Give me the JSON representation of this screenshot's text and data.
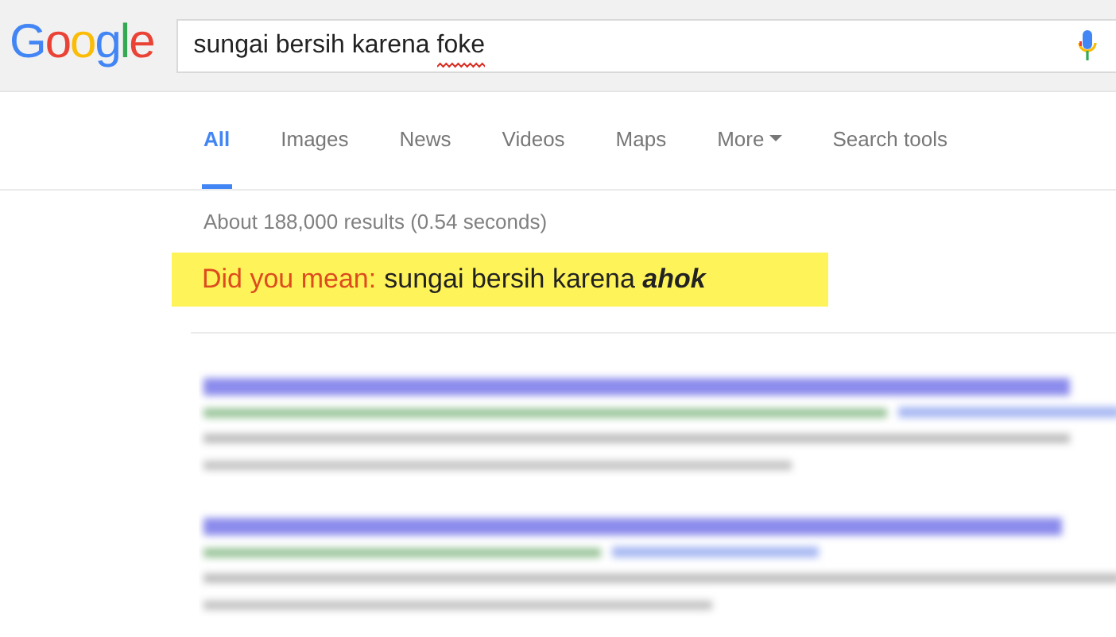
{
  "logo": "Google",
  "query_words": [
    {
      "text": "sungai",
      "misspelled": false
    },
    {
      "text": "bersih",
      "misspelled": false
    },
    {
      "text": "karena",
      "misspelled": false
    },
    {
      "text": "foke",
      "misspelled": true
    }
  ],
  "tabs": [
    {
      "label": "All",
      "selected": true,
      "kind": "tab"
    },
    {
      "label": "Images",
      "selected": false,
      "kind": "tab"
    },
    {
      "label": "News",
      "selected": false,
      "kind": "tab"
    },
    {
      "label": "Videos",
      "selected": false,
      "kind": "tab"
    },
    {
      "label": "Maps",
      "selected": false,
      "kind": "tab"
    },
    {
      "label": "More",
      "selected": false,
      "kind": "menu"
    },
    {
      "label": "Search tools",
      "selected": false,
      "kind": "tab"
    }
  ],
  "result_stats": "About 188,000 results (0.54 seconds)",
  "did_you_mean": {
    "label": "Did you mean:",
    "suggestion": "sungai bersih karena **ahok**"
  },
  "results": [
    {
      "kind": "blurred"
    },
    {
      "kind": "blurred"
    }
  ]
}
